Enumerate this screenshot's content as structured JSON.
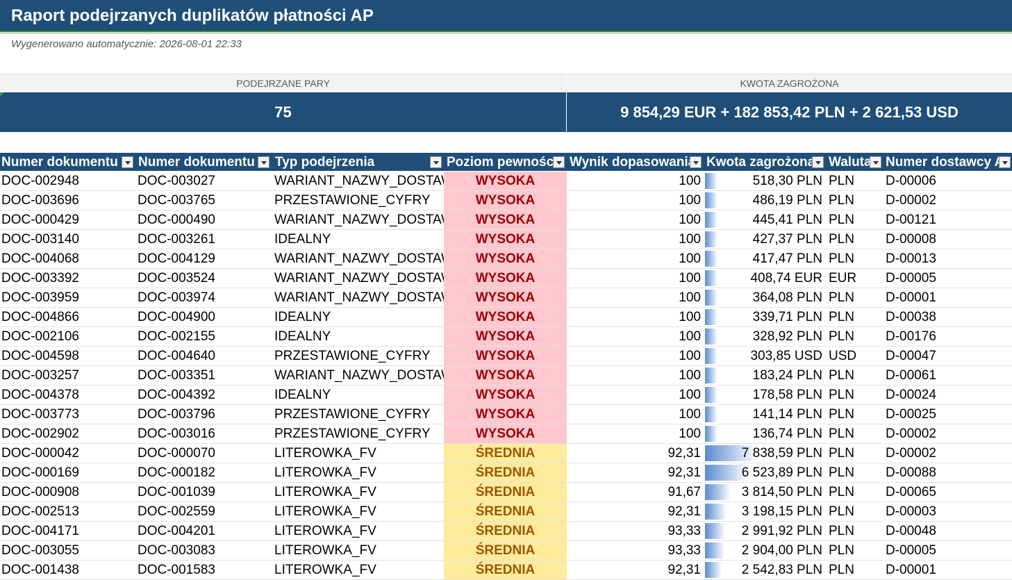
{
  "report": {
    "title": "Raport podejrzanych duplikatów płatności AP",
    "generated": "Wygenerowano automatycznie: 2026-08-01 22:33"
  },
  "kpi": {
    "pairs_label": "PODEJRZANE PARY",
    "pairs_value": "75",
    "amount_label": "KWOTA ZAGROŻONA",
    "amount_value": "9 854,29 EUR + 182 853,42 PLN + 2 621,53 USD"
  },
  "table": {
    "headers": [
      "Numer dokumentu A",
      "Numer dokumentu",
      "Typ podejrzenia",
      "Poziom pewności",
      "Wynik dopasowania",
      "Kwota zagrożona",
      "Waluta",
      "Numer dostawcy A"
    ],
    "rows": [
      {
        "doc_a": "DOC-002948",
        "doc_b": "DOC-003027",
        "type": "WARIANT_NAZWY_DOSTAWCY",
        "level": "WYSOKA",
        "score": "100",
        "amount": "518,30 PLN",
        "bar": 0.066,
        "currency": "PLN",
        "vendor": "D-00006"
      },
      {
        "doc_a": "DOC-003696",
        "doc_b": "DOC-003765",
        "type": "PRZESTAWIONE_CYFRY",
        "level": "WYSOKA",
        "score": "100",
        "amount": "486,19 PLN",
        "bar": 0.062,
        "currency": "PLN",
        "vendor": "D-00002"
      },
      {
        "doc_a": "DOC-000429",
        "doc_b": "DOC-000490",
        "type": "WARIANT_NAZWY_DOSTAWCY",
        "level": "WYSOKA",
        "score": "100",
        "amount": "445,41 PLN",
        "bar": 0.057,
        "currency": "PLN",
        "vendor": "D-00121"
      },
      {
        "doc_a": "DOC-003140",
        "doc_b": "DOC-003261",
        "type": "IDEALNY",
        "level": "WYSOKA",
        "score": "100",
        "amount": "427,37 PLN",
        "bar": 0.055,
        "currency": "PLN",
        "vendor": "D-00008"
      },
      {
        "doc_a": "DOC-004068",
        "doc_b": "DOC-004129",
        "type": "WARIANT_NAZWY_DOSTAWCY",
        "level": "WYSOKA",
        "score": "100",
        "amount": "417,47 PLN",
        "bar": 0.053,
        "currency": "PLN",
        "vendor": "D-00013"
      },
      {
        "doc_a": "DOC-003392",
        "doc_b": "DOC-003524",
        "type": "WARIANT_NAZWY_DOSTAWCY",
        "level": "WYSOKA",
        "score": "100",
        "amount": "408,74 EUR",
        "bar": 0.052,
        "currency": "EUR",
        "vendor": "D-00005"
      },
      {
        "doc_a": "DOC-003959",
        "doc_b": "DOC-003974",
        "type": "WARIANT_NAZWY_DOSTAWCY",
        "level": "WYSOKA",
        "score": "100",
        "amount": "364,08 PLN",
        "bar": 0.046,
        "currency": "PLN",
        "vendor": "D-00001"
      },
      {
        "doc_a": "DOC-004866",
        "doc_b": "DOC-004900",
        "type": "IDEALNY",
        "level": "WYSOKA",
        "score": "100",
        "amount": "339,71 PLN",
        "bar": 0.043,
        "currency": "PLN",
        "vendor": "D-00038"
      },
      {
        "doc_a": "DOC-002106",
        "doc_b": "DOC-002155",
        "type": "IDEALNY",
        "level": "WYSOKA",
        "score": "100",
        "amount": "328,92 PLN",
        "bar": 0.042,
        "currency": "PLN",
        "vendor": "D-00176"
      },
      {
        "doc_a": "DOC-004598",
        "doc_b": "DOC-004640",
        "type": "PRZESTAWIONE_CYFRY",
        "level": "WYSOKA",
        "score": "100",
        "amount": "303,85 USD",
        "bar": 0.039,
        "currency": "USD",
        "vendor": "D-00047"
      },
      {
        "doc_a": "DOC-003257",
        "doc_b": "DOC-003351",
        "type": "WARIANT_NAZWY_DOSTAWCY",
        "level": "WYSOKA",
        "score": "100",
        "amount": "183,24 PLN",
        "bar": 0.023,
        "currency": "PLN",
        "vendor": "D-00061"
      },
      {
        "doc_a": "DOC-004378",
        "doc_b": "DOC-004392",
        "type": "IDEALNY",
        "level": "WYSOKA",
        "score": "100",
        "amount": "178,58 PLN",
        "bar": 0.023,
        "currency": "PLN",
        "vendor": "D-00024"
      },
      {
        "doc_a": "DOC-003773",
        "doc_b": "DOC-003796",
        "type": "PRZESTAWIONE_CYFRY",
        "level": "WYSOKA",
        "score": "100",
        "amount": "141,14 PLN",
        "bar": 0.018,
        "currency": "PLN",
        "vendor": "D-00025"
      },
      {
        "doc_a": "DOC-002902",
        "doc_b": "DOC-003016",
        "type": "PRZESTAWIONE_CYFRY",
        "level": "WYSOKA",
        "score": "100",
        "amount": "136,74 PLN",
        "bar": 0.017,
        "currency": "PLN",
        "vendor": "D-00002"
      },
      {
        "doc_a": "DOC-000042",
        "doc_b": "DOC-000070",
        "type": "LITEROWKA_FV",
        "level": "ŚREDNIA",
        "score": "92,31",
        "amount": "7 838,59 PLN",
        "bar": 1.0,
        "currency": "PLN",
        "vendor": "D-00002"
      },
      {
        "doc_a": "DOC-000169",
        "doc_b": "DOC-000182",
        "type": "LITEROWKA_FV",
        "level": "ŚREDNIA",
        "score": "92,31",
        "amount": "6 523,89 PLN",
        "bar": 0.832,
        "currency": "PLN",
        "vendor": "D-00088"
      },
      {
        "doc_a": "DOC-000908",
        "doc_b": "DOC-001039",
        "type": "LITEROWKA_FV",
        "level": "ŚREDNIA",
        "score": "91,67",
        "amount": "3 814,50 PLN",
        "bar": 0.487,
        "currency": "PLN",
        "vendor": "D-00065"
      },
      {
        "doc_a": "DOC-002513",
        "doc_b": "DOC-002559",
        "type": "LITEROWKA_FV",
        "level": "ŚREDNIA",
        "score": "92,31",
        "amount": "3 198,15 PLN",
        "bar": 0.408,
        "currency": "PLN",
        "vendor": "D-00003"
      },
      {
        "doc_a": "DOC-004171",
        "doc_b": "DOC-004201",
        "type": "LITEROWKA_FV",
        "level": "ŚREDNIA",
        "score": "93,33",
        "amount": "2 991,92 PLN",
        "bar": 0.382,
        "currency": "PLN",
        "vendor": "D-00048"
      },
      {
        "doc_a": "DOC-003055",
        "doc_b": "DOC-003083",
        "type": "LITEROWKA_FV",
        "level": "ŚREDNIA",
        "score": "93,33",
        "amount": "2 904,00 PLN",
        "bar": 0.37,
        "currency": "PLN",
        "vendor": "D-00005"
      },
      {
        "doc_a": "DOC-001438",
        "doc_b": "DOC-001583",
        "type": "LITEROWKA_FV",
        "level": "ŚREDNIA",
        "score": "92,31",
        "amount": "2 542,83 PLN",
        "bar": 0.324,
        "currency": "PLN",
        "vendor": "D-00001"
      }
    ]
  },
  "colors": {
    "header_bg": "#1f4e79",
    "high_bg": "#ffc7ce",
    "high_text": "#9c0006",
    "mid_bg": "#ffeb9c",
    "mid_text": "#9c5700",
    "databar": "#5b8bd0"
  }
}
